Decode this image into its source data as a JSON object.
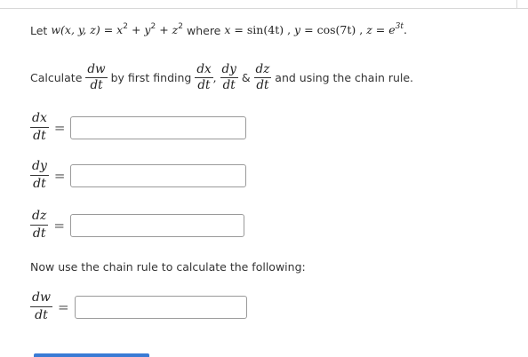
{
  "problem": {
    "intro": "Let",
    "func_lhs": "w(x, y, z)",
    "equals": "=",
    "func_rhs_terms": [
      "x",
      "2",
      "+",
      "y",
      "2",
      "+",
      "z",
      "2"
    ],
    "where_text": "where",
    "x_def": {
      "var": "x",
      "eq": "=",
      "fn": "sin",
      "arg": "(4t)"
    },
    "y_def": {
      "var": "y",
      "eq": "=",
      "fn": "cos",
      "arg": "(7t)"
    },
    "z_def": {
      "var": "z",
      "eq": "=",
      "base": "e",
      "exp": "3t"
    },
    "sep": ",",
    "period": "."
  },
  "instruction": {
    "calculate": "Calculate",
    "dw_num": "dw",
    "dw_den": "dt",
    "by_first_finding": "by first finding",
    "dx_num": "dx",
    "dx_den": "dt",
    "dy_num": "dy",
    "dy_den": "dt",
    "amp": "&",
    "dz_num": "dz",
    "dz_den": "dt",
    "comma": ",",
    "tail": "and using the chain rule."
  },
  "answers": [
    {
      "num": "dx",
      "den": "dt",
      "eq": "=",
      "value": ""
    },
    {
      "num": "dy",
      "den": "dt",
      "eq": "=",
      "value": ""
    },
    {
      "num": "dz",
      "den": "dt",
      "eq": "=",
      "value": ""
    }
  ],
  "chain_rule_prompt": "Now use the chain rule to calculate the following:",
  "final_answer": {
    "num": "dw",
    "den": "dt",
    "eq": "=",
    "value": ""
  },
  "colors": {
    "text": "#333333",
    "input_border": "#9a9a9a",
    "accent_bar": "#3a7bd5"
  }
}
